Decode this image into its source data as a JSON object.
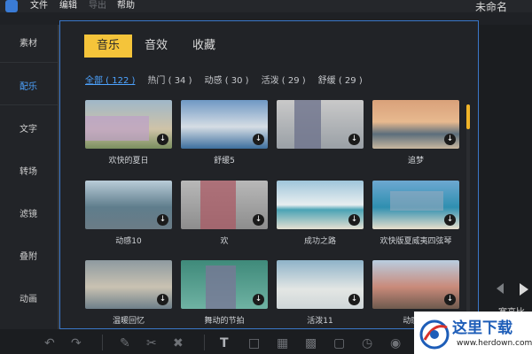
{
  "menubar": {
    "items": [
      {
        "label": "文件"
      },
      {
        "label": "编辑"
      },
      {
        "label": "导出"
      },
      {
        "label": "帮助"
      }
    ],
    "title": "未命名"
  },
  "sidebar": {
    "items": [
      {
        "label": "素材"
      },
      {
        "label": "配乐"
      },
      {
        "label": "文字"
      },
      {
        "label": "转场"
      },
      {
        "label": "滤镜"
      },
      {
        "label": "叠附"
      },
      {
        "label": "动画"
      }
    ]
  },
  "tabs": [
    {
      "label": "音乐"
    },
    {
      "label": "音效"
    },
    {
      "label": "收藏"
    }
  ],
  "filters": [
    {
      "label": "全部 ( 122 )"
    },
    {
      "label": "热门 ( 34 )"
    },
    {
      "label": "动感 ( 30 )"
    },
    {
      "label": "活泼 ( 29 )"
    },
    {
      "label": "舒缓 ( 29 )"
    }
  ],
  "cards": [
    {
      "label": "欢快的夏日",
      "icon": "download-icon"
    },
    {
      "label": "舒缓5",
      "icon": "download-icon"
    },
    {
      "label": "",
      "icon": "download-icon"
    },
    {
      "label": "追梦",
      "icon": "download-icon"
    },
    {
      "label": "动感10",
      "icon": "download-icon"
    },
    {
      "label": "欢",
      "icon": "download-icon"
    },
    {
      "label": "成功之路",
      "icon": "download-icon"
    },
    {
      "label": "欢快版夏威夷四弦琴",
      "icon": "download-icon"
    },
    {
      "label": "温暖回忆",
      "icon": "download-icon"
    },
    {
      "label": "舞动的节拍",
      "icon": "download-icon"
    },
    {
      "label": "活泼11",
      "icon": "download-icon"
    },
    {
      "label": "动感11",
      "icon": "download-icon"
    }
  ],
  "right_panel": {
    "label": "宽高比"
  },
  "watermark": {
    "text": "这里下载",
    "url": "www.herdown.com"
  },
  "colors": {
    "accent": "#f5c43a",
    "selection": "#4da3ff",
    "panel_border": "#3a77c9"
  }
}
